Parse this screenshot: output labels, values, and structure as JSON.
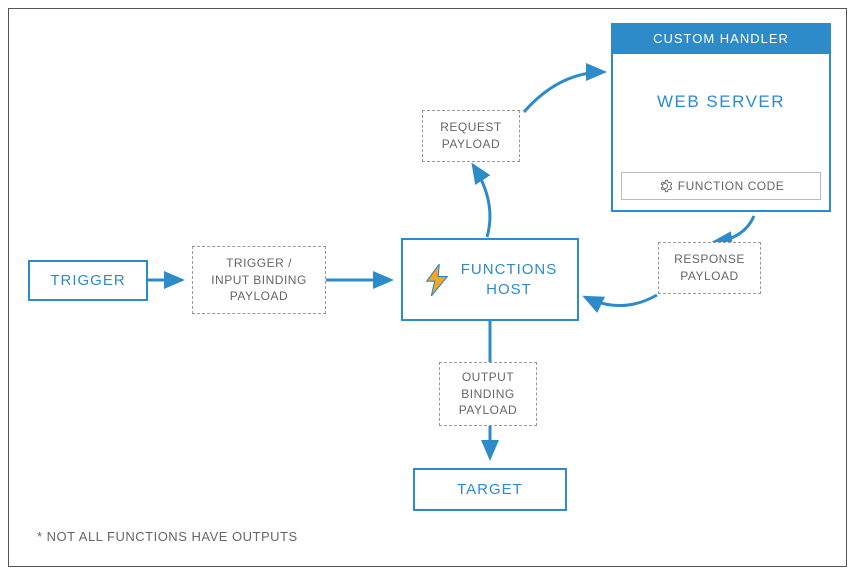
{
  "diagram": {
    "trigger": "TRIGGER",
    "trigger_payload": "TRIGGER /\nINPUT BINDING\nPAYLOAD",
    "functions_host": "FUNCTIONS\nHOST",
    "request_payload": "REQUEST\nPAYLOAD",
    "response_payload": "RESPONSE\nPAYLOAD",
    "output_payload": "OUTPUT\nBINDING\nPAYLOAD",
    "target": "TARGET",
    "custom_handler_header": "CUSTOM HANDLER",
    "web_server": "WEB SERVER",
    "function_code": "FUNCTION CODE",
    "footnote": "* NOT ALL FUNCTIONS HAVE OUTPUTS"
  },
  "colors": {
    "primary": "#2e8bc9",
    "dashed_border": "#999999",
    "text_gray": "#666666",
    "bolt_yellow": "#f5a623"
  }
}
